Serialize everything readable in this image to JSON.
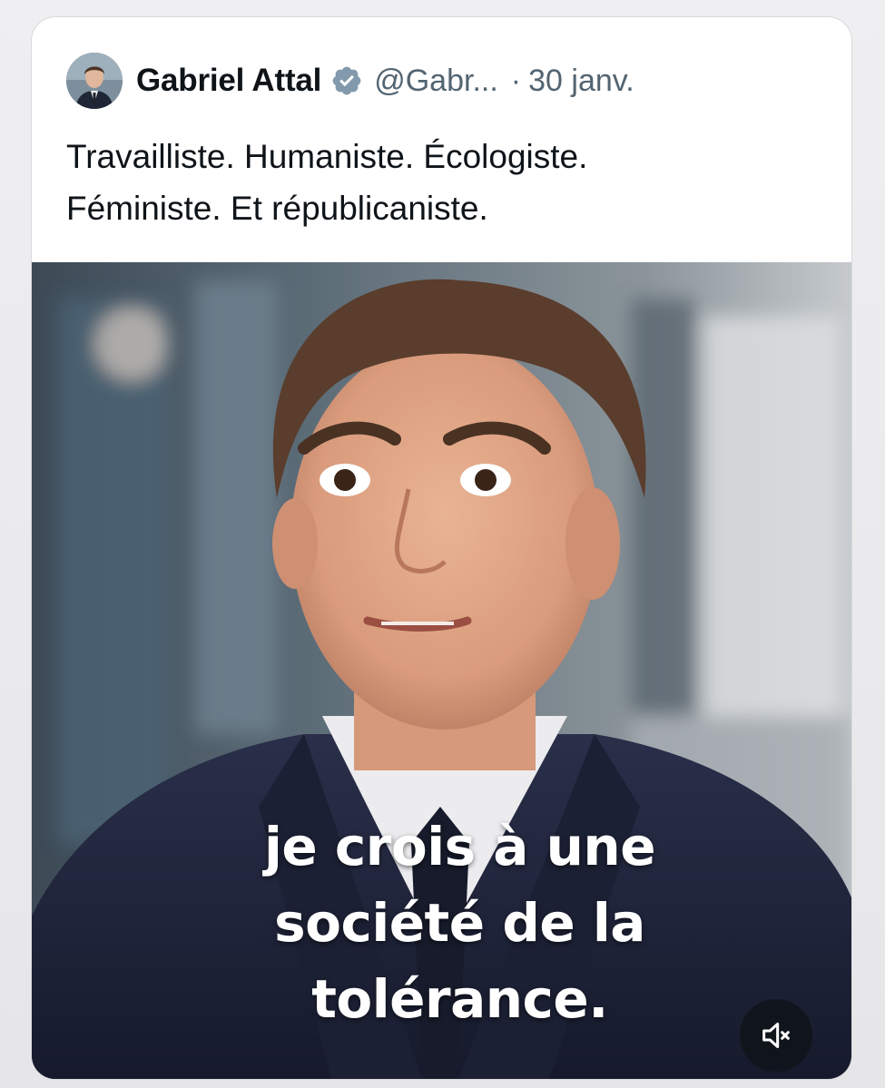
{
  "tweet": {
    "author_name": "Gabriel Attal",
    "author_handle": "@Gabr...",
    "separator": "·",
    "date": "30 janv.",
    "text_lines": [
      "Travailliste. Humaniste. Écologiste.",
      "Féministe. Et républicaniste."
    ]
  },
  "video": {
    "subtitle_lines": [
      "je crois à une",
      "société de la",
      "tolérance."
    ],
    "mute_icon": "speaker-muted-icon"
  },
  "icons": {
    "verified": "verified-badge-icon",
    "avatar": "avatar"
  },
  "colors": {
    "text_primary": "#0f1419",
    "text_secondary": "#536471",
    "verified_badge": "#829aab",
    "card_background": "#ffffff"
  }
}
